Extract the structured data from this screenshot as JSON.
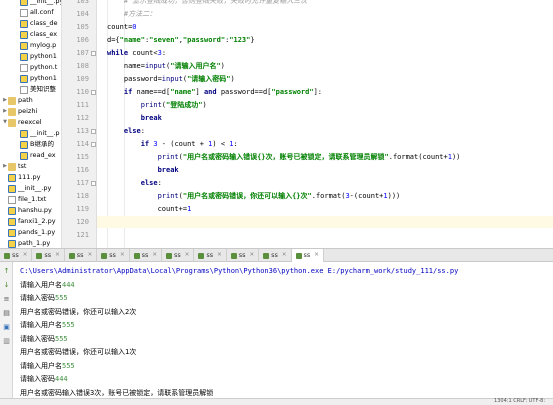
{
  "project_tree": {
    "items": [
      {
        "label": "__init__.py",
        "icon": "py",
        "indent": 2,
        "arrow": ""
      },
      {
        "label": "all.conf",
        "icon": "txt",
        "indent": 2,
        "arrow": ""
      },
      {
        "label": "class_de",
        "icon": "py",
        "indent": 2,
        "arrow": ""
      },
      {
        "label": "class_ex",
        "icon": "py",
        "indent": 2,
        "arrow": ""
      },
      {
        "label": "mylog.p",
        "icon": "py",
        "indent": 2,
        "arrow": ""
      },
      {
        "label": "python1",
        "icon": "py",
        "indent": 2,
        "arrow": ""
      },
      {
        "label": "python.t",
        "icon": "txt",
        "indent": 2,
        "arrow": ""
      },
      {
        "label": "python1",
        "icon": "py",
        "indent": 2,
        "arrow": ""
      },
      {
        "label": "美知识整",
        "icon": "txt",
        "indent": 2,
        "arrow": ""
      },
      {
        "label": "path",
        "icon": "folder",
        "indent": 1,
        "arrow": "▶"
      },
      {
        "label": "peizhi",
        "icon": "folder",
        "indent": 1,
        "arrow": "▶"
      },
      {
        "label": "reexcel",
        "icon": "folder",
        "indent": 1,
        "arrow": "▼"
      },
      {
        "label": "__init__.p",
        "icon": "py",
        "indent": 2,
        "arrow": ""
      },
      {
        "label": "B继承的",
        "icon": "py",
        "indent": 2,
        "arrow": ""
      },
      {
        "label": "read_ex",
        "icon": "py",
        "indent": 2,
        "arrow": ""
      },
      {
        "label": "tst",
        "icon": "folder",
        "indent": 1,
        "arrow": "▶"
      },
      {
        "label": "111.py",
        "icon": "py",
        "indent": 1,
        "arrow": ""
      },
      {
        "label": "__init__.py",
        "icon": "py",
        "indent": 1,
        "arrow": ""
      },
      {
        "label": "file_1.txt",
        "icon": "txt",
        "indent": 1,
        "arrow": ""
      },
      {
        "label": "hanshu.py",
        "icon": "py",
        "indent": 1,
        "arrow": ""
      },
      {
        "label": "fanxi1_2.py",
        "icon": "py",
        "indent": 1,
        "arrow": ""
      },
      {
        "label": "pands_1.py",
        "icon": "py",
        "indent": 1,
        "arrow": ""
      },
      {
        "label": "path_1.py",
        "icon": "py",
        "indent": 1,
        "arrow": ""
      }
    ]
  },
  "editor": {
    "line_numbers": [
      "103",
      "104",
      "105",
      "106",
      "107",
      "108",
      "109",
      "110",
      "111",
      "112",
      "113",
      "114",
      "115",
      "116",
      "117",
      "118",
      "119",
      "120",
      "121"
    ],
    "current_line_index": 17,
    "lines": [
      [
        {
          "t": "    # 显示登陆成功，否则登陆失败，失败时允许重复输入三次",
          "c": "cm"
        }
      ],
      [
        {
          "t": "    #方法二：",
          "c": "cm"
        }
      ],
      [
        {
          "t": "count",
          "c": ""
        },
        {
          "t": "=",
          "c": ""
        },
        {
          "t": "0",
          "c": "num"
        }
      ],
      [
        {
          "t": "d",
          "c": ""
        },
        {
          "t": "={",
          "c": ""
        },
        {
          "t": "\"name\"",
          "c": "str"
        },
        {
          "t": ":",
          "c": ""
        },
        {
          "t": "\"seven\"",
          "c": "str"
        },
        {
          "t": ",",
          "c": ""
        },
        {
          "t": "\"password\"",
          "c": "str"
        },
        {
          "t": ":",
          "c": ""
        },
        {
          "t": "\"123\"",
          "c": "str"
        },
        {
          "t": "}",
          "c": ""
        }
      ],
      [
        {
          "t": "while ",
          "c": "kw"
        },
        {
          "t": "count<",
          "c": ""
        },
        {
          "t": "3",
          "c": "num"
        },
        {
          "t": ":",
          "c": ""
        }
      ],
      [
        {
          "t": "    name=",
          "c": ""
        },
        {
          "t": "input",
          "c": "bi"
        },
        {
          "t": "(",
          "c": ""
        },
        {
          "t": "\"请输入用户名\"",
          "c": "str"
        },
        {
          "t": ")",
          "c": ""
        }
      ],
      [
        {
          "t": "    password=",
          "c": ""
        },
        {
          "t": "input",
          "c": "bi"
        },
        {
          "t": "(",
          "c": ""
        },
        {
          "t": "\"请输入密码\"",
          "c": "str"
        },
        {
          "t": ")",
          "c": ""
        }
      ],
      [
        {
          "t": "    ",
          "c": ""
        },
        {
          "t": "if ",
          "c": "kw"
        },
        {
          "t": "name==d[",
          "c": ""
        },
        {
          "t": "\"name\"",
          "c": "str"
        },
        {
          "t": "] ",
          "c": ""
        },
        {
          "t": "and ",
          "c": "kw"
        },
        {
          "t": "password==d[",
          "c": ""
        },
        {
          "t": "\"password\"",
          "c": "str"
        },
        {
          "t": "]:",
          "c": ""
        }
      ],
      [
        {
          "t": "        ",
          "c": ""
        },
        {
          "t": "print",
          "c": "bi"
        },
        {
          "t": "(",
          "c": ""
        },
        {
          "t": "\"登陆成功\"",
          "c": "str"
        },
        {
          "t": ")",
          "c": ""
        }
      ],
      [
        {
          "t": "        ",
          "c": ""
        },
        {
          "t": "break",
          "c": "kw"
        }
      ],
      [
        {
          "t": "    ",
          "c": ""
        },
        {
          "t": "else",
          "c": "kw"
        },
        {
          "t": ":",
          "c": ""
        }
      ],
      [
        {
          "t": "        ",
          "c": ""
        },
        {
          "t": "if ",
          "c": "kw"
        },
        {
          "t": "3",
          "c": "num"
        },
        {
          "t": " - (count + ",
          "c": ""
        },
        {
          "t": "1",
          "c": "num"
        },
        {
          "t": ") < ",
          "c": ""
        },
        {
          "t": "1",
          "c": "num"
        },
        {
          "t": ":",
          "c": ""
        }
      ],
      [
        {
          "t": "            ",
          "c": ""
        },
        {
          "t": "print",
          "c": "bi"
        },
        {
          "t": "(",
          "c": ""
        },
        {
          "t": "\"用户名或密码输入错误{}次，账号已被锁定，请联系管理员解锁\"",
          "c": "str"
        },
        {
          "t": ".format(count+",
          "c": ""
        },
        {
          "t": "1",
          "c": "num"
        },
        {
          "t": "))",
          "c": ""
        }
      ],
      [
        {
          "t": "            ",
          "c": ""
        },
        {
          "t": "break",
          "c": "kw"
        }
      ],
      [
        {
          "t": "        ",
          "c": ""
        },
        {
          "t": "else",
          "c": "kw"
        },
        {
          "t": ":",
          "c": ""
        }
      ],
      [
        {
          "t": "            ",
          "c": ""
        },
        {
          "t": "print",
          "c": "bi"
        },
        {
          "t": "(",
          "c": ""
        },
        {
          "t": "\"用户名或密码错误，你还可以输入{}次\"",
          "c": "str"
        },
        {
          "t": ".format(",
          "c": ""
        },
        {
          "t": "3",
          "c": "num"
        },
        {
          "t": "-(count+",
          "c": ""
        },
        {
          "t": "1",
          "c": "num"
        },
        {
          "t": ")))",
          "c": ""
        }
      ],
      [
        {
          "t": "            count+=",
          "c": ""
        },
        {
          "t": "1",
          "c": "num"
        }
      ],
      [
        {
          "t": "",
          "c": ""
        }
      ],
      [
        {
          "t": "",
          "c": ""
        }
      ]
    ]
  },
  "run_tabs": {
    "items": [
      {
        "label": "ss",
        "active": false
      },
      {
        "label": "ss",
        "active": false
      },
      {
        "label": "ss",
        "active": false
      },
      {
        "label": "ss",
        "active": false
      },
      {
        "label": "ss",
        "active": false
      },
      {
        "label": "ss",
        "active": false
      },
      {
        "label": "ss",
        "active": false
      },
      {
        "label": "ss",
        "active": false
      },
      {
        "label": "ss",
        "active": false
      },
      {
        "label": "ss",
        "active": true
      }
    ]
  },
  "console": {
    "lines": [
      {
        "parts": [
          {
            "t": "C:\\Users\\Administrator\\AppData\\Local\\Programs\\Python\\Python36\\python.exe E:/pycharm_work/study_111/ss.py",
            "c": "con-cmd"
          }
        ]
      },
      {
        "parts": [
          {
            "t": "请输入用户名",
            "c": "con-out"
          },
          {
            "t": "444",
            "c": "con-in"
          }
        ]
      },
      {
        "parts": [
          {
            "t": "请输入密码",
            "c": "con-out"
          },
          {
            "t": "555",
            "c": "con-in"
          }
        ]
      },
      {
        "parts": [
          {
            "t": "用户名或密码错误，你还可以输入2次",
            "c": "con-out"
          }
        ]
      },
      {
        "parts": [
          {
            "t": "请输入用户名",
            "c": "con-out"
          },
          {
            "t": "555",
            "c": "con-in"
          }
        ]
      },
      {
        "parts": [
          {
            "t": "请输入密码",
            "c": "con-out"
          },
          {
            "t": "555",
            "c": "con-in"
          }
        ]
      },
      {
        "parts": [
          {
            "t": "用户名或密码错误，你还可以输入1次",
            "c": "con-out"
          }
        ]
      },
      {
        "parts": [
          {
            "t": "请输入用户名",
            "c": "con-out"
          },
          {
            "t": "555",
            "c": "con-in"
          }
        ]
      },
      {
        "parts": [
          {
            "t": "请输入密码",
            "c": "con-out"
          },
          {
            "t": "444",
            "c": "con-in"
          }
        ]
      },
      {
        "parts": [
          {
            "t": "用户名或密码输入错误3次，账号已被锁定，请联系管理员解锁",
            "c": "con-out"
          }
        ]
      }
    ]
  },
  "toolbar_icons": [
    "rerun-icon",
    "stop-icon",
    "scroll-icon",
    "print-icon",
    "pin-icon",
    "trash-icon"
  ],
  "status": {
    "text": "1304:1  CRLF:  UTF-8:"
  }
}
